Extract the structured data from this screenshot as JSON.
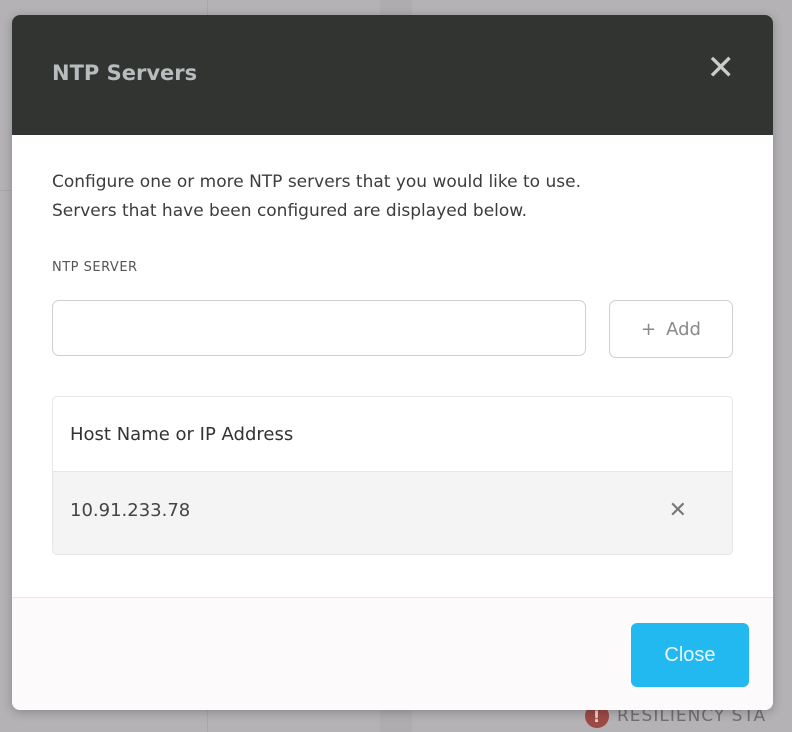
{
  "background": {
    "status_text": "RESILIENCY STA",
    "alert_icon": "!",
    "alert_color": "#9d4a45"
  },
  "modal": {
    "title": "NTP Servers",
    "close_icon": "✕",
    "description_line1": "Configure one or more NTP servers that you would like to use.",
    "description_line2": "Servers that have been configured are displayed below.",
    "field_label": "NTP SERVER",
    "input_value": "",
    "add_icon": "+",
    "add_label": "Add",
    "table": {
      "header": "Host Name or IP Address",
      "rows": [
        {
          "host": "10.91.233.78",
          "remove_icon": "✕"
        }
      ]
    },
    "close_label": "Close",
    "accent_color": "#22b8f0"
  }
}
